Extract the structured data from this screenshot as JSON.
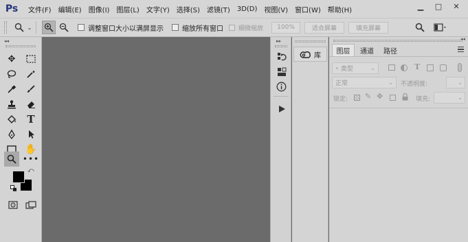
{
  "app": {
    "logo": "Ps"
  },
  "menu": {
    "items": [
      "文件(F)",
      "编辑(E)",
      "图像(I)",
      "图层(L)",
      "文字(Y)",
      "选择(S)",
      "滤镜(T)",
      "3D(D)",
      "视图(V)",
      "窗口(W)",
      "帮助(H)"
    ]
  },
  "window_controls": {
    "minimize": "▁",
    "maximize": "□",
    "close": "✕"
  },
  "options": {
    "check_resize_window": "调整窗口大小以满屏显示",
    "check_zoom_all": "缩放所有窗口",
    "btn_scrubby": "细微缩放",
    "btn_100": "100%",
    "btn_fit": "适合屏幕",
    "btn_fill": "填充屏幕"
  },
  "library": {
    "label": "库"
  },
  "layers_panel": {
    "tabs": [
      "图层",
      "通道",
      "路径"
    ],
    "filter_kind": "类型",
    "blend_mode": "正常",
    "opacity_label": "不透明度:",
    "lock_label": "锁定:",
    "fill_label": "填充:"
  }
}
